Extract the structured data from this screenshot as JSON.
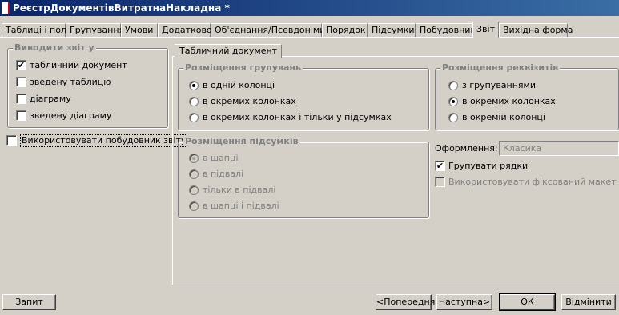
{
  "window": {
    "title": "РеєстрДокументівВитратнаНакладна *"
  },
  "tabs": [
    {
      "label": "Таблиці і поля"
    },
    {
      "label": "Групування"
    },
    {
      "label": "Умови"
    },
    {
      "label": "Додатково"
    },
    {
      "label": "Об'єднання/Псевдоніми"
    },
    {
      "label": "Порядок"
    },
    {
      "label": "Підсумки"
    },
    {
      "label": "Побудовник"
    },
    {
      "label": "Звіт"
    },
    {
      "label": "Вихідна форма"
    }
  ],
  "output": {
    "legend": "Виводити звіт у",
    "items": [
      {
        "label": "табличний документ",
        "checked": "✔"
      },
      {
        "label": "зведену таблицю",
        "checked": ""
      },
      {
        "label": "діаграму",
        "checked": ""
      },
      {
        "label": "зведену діаграму",
        "checked": ""
      }
    ]
  },
  "use_builder": {
    "label": "Використовувати побудовник звіту",
    "checked": ""
  },
  "subtab": {
    "label": "Табличний документ"
  },
  "grouping_placement": {
    "legend": "Розміщення групувань",
    "options": [
      {
        "label": "в одній колонці",
        "selected": true
      },
      {
        "label": "в окремих колонках",
        "selected": false
      },
      {
        "label": "в окремих колонках і тільки у підсумках",
        "selected": false
      }
    ]
  },
  "details_placement": {
    "legend": "Розміщення реквізитів",
    "options": [
      {
        "label": "з групуваннями",
        "selected": false
      },
      {
        "label": "в окремих колонках",
        "selected": true
      },
      {
        "label": "в окремій колонці",
        "selected": false
      }
    ]
  },
  "totals_placement": {
    "legend": "Розміщення підсумків",
    "options": [
      {
        "label": "в шапці",
        "selected": true
      },
      {
        "label": "в підвалі",
        "selected": false
      },
      {
        "label": "тільки в підвалі",
        "selected": false
      },
      {
        "label": "в шапці і підвалі",
        "selected": false
      }
    ]
  },
  "design": {
    "label": "Оформлення:",
    "value": "Класика"
  },
  "group_rows": {
    "label": "Групувати рядки",
    "checked": "✔"
  },
  "fixed_layout": {
    "label": "Використовувати фіксований макет",
    "checked": ""
  },
  "buttons": {
    "query": "Запит",
    "prev": "<Попередня",
    "next": "Наступна>",
    "ok": "ОК",
    "cancel": "Відмінити"
  }
}
